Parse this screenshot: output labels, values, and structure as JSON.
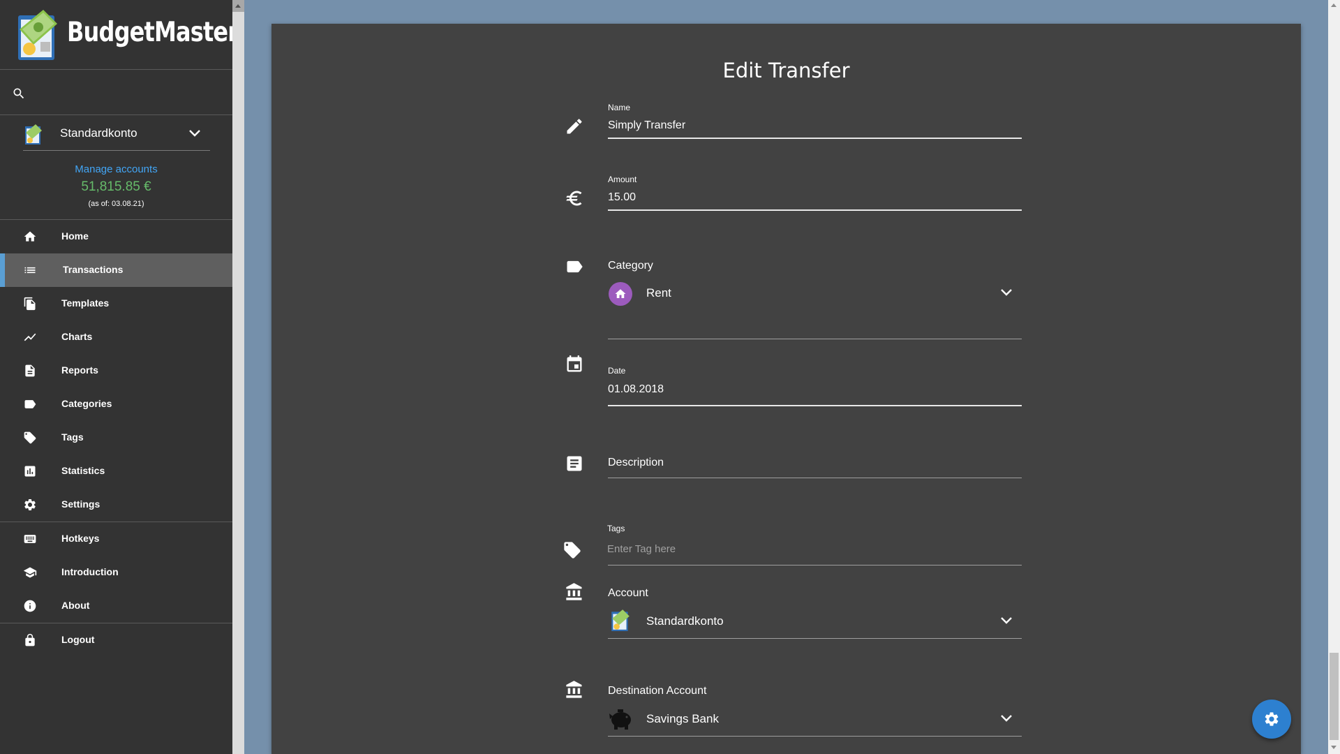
{
  "app": {
    "name": "BudgetMaster"
  },
  "sidebar": {
    "account": {
      "name": "Standardkonto",
      "manage_label": "Manage accounts",
      "balance": "51,815.85 €",
      "as_of": "(as of: 03.08.21)",
      "balance_color": "#66bb6a"
    },
    "items": [
      {
        "label": "Home",
        "icon": "home-icon"
      },
      {
        "label": "Transactions",
        "icon": "list-icon",
        "active": true
      },
      {
        "label": "Templates",
        "icon": "templates-icon"
      },
      {
        "label": "Charts",
        "icon": "chart-line-icon"
      },
      {
        "label": "Reports",
        "icon": "report-icon"
      },
      {
        "label": "Categories",
        "icon": "label-icon"
      },
      {
        "label": "Tags",
        "icon": "tag-icon"
      },
      {
        "label": "Statistics",
        "icon": "statistics-icon"
      },
      {
        "label": "Settings",
        "icon": "gear-icon"
      },
      {
        "label": "Hotkeys",
        "icon": "keyboard-icon"
      },
      {
        "label": "Introduction",
        "icon": "school-icon"
      },
      {
        "label": "About",
        "icon": "info-icon"
      },
      {
        "label": "Logout",
        "icon": "lock-icon"
      }
    ]
  },
  "form": {
    "title": "Edit Transfer",
    "name": {
      "label": "Name",
      "value": "Simply Transfer"
    },
    "amount": {
      "label": "Amount",
      "value": "15.00"
    },
    "category": {
      "label": "Category",
      "value": "Rent",
      "color": "#9c5bbd"
    },
    "date": {
      "label": "Date",
      "value": "01.08.2018"
    },
    "description": {
      "label": "Description",
      "value": ""
    },
    "tags": {
      "label": "Tags",
      "placeholder": "Enter Tag here"
    },
    "account": {
      "label": "Account",
      "value": "Standardkonto"
    },
    "destination_account": {
      "label": "Destination Account",
      "value": "Savings Bank"
    }
  },
  "colors": {
    "accent": "#2d80d0",
    "link": "#42a5f5",
    "active_indicator": "#5a9fd4"
  }
}
